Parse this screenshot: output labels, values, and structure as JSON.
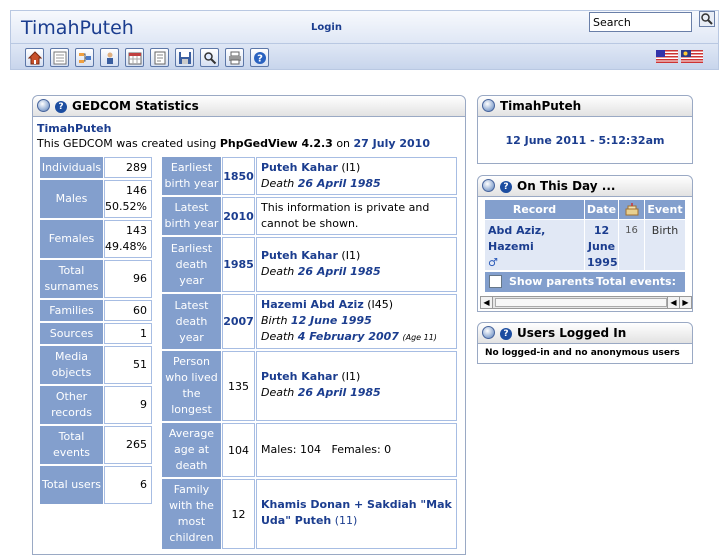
{
  "header": {
    "site_title": "TimahPuteh",
    "login_label": "Login",
    "search_placeholder": "Search"
  },
  "toolbar": {
    "icons": [
      "home-icon",
      "list-icon",
      "tree-icon",
      "individual-icon",
      "calendar-icon",
      "report-icon",
      "save-icon",
      "search-icon",
      "print-icon",
      "help-icon"
    ],
    "flags": [
      "us-flag-icon",
      "malaysia-flag-icon"
    ]
  },
  "gedcom_stats": {
    "title": "GEDCOM Statistics",
    "site_name": "TimahPuteh",
    "created_prefix": "This GEDCOM was created using ",
    "software": "PhpGedView 4.2.3",
    "created_on": " on ",
    "created_date": "27 July 2010",
    "left_table": [
      {
        "label": "Individuals",
        "value": "289"
      },
      {
        "label": "Males",
        "value": "146",
        "value2": "50.52%"
      },
      {
        "label": "Females",
        "value": "143",
        "value2": "49.48%"
      },
      {
        "label": "Total surnames",
        "value": "96"
      },
      {
        "label": "Families",
        "value": "60"
      },
      {
        "label": "Sources",
        "value": "1"
      },
      {
        "label": "Media objects",
        "value": "51"
      },
      {
        "label": "Other records",
        "value": "9"
      },
      {
        "label": "Total events",
        "value": "265"
      },
      {
        "label": "Total users",
        "value": "6"
      }
    ],
    "right_table": {
      "earliest_birth": {
        "label": "Earliest birth year",
        "year": "1850",
        "name": "Puteh Kahar",
        "id": "(I1)",
        "event_word": "Death",
        "event_date": "26 April 1985"
      },
      "latest_birth": {
        "label": "Latest birth year",
        "year": "2010",
        "text": "This information is private and cannot be shown."
      },
      "earliest_death": {
        "label": "Earliest death year",
        "year": "1985",
        "name": "Puteh Kahar",
        "id": "(I1)",
        "event_word": "Death",
        "event_date": "26 April 1985"
      },
      "latest_death": {
        "label": "Latest death year",
        "year": "2007",
        "name": "Hazemi Abd Aziz",
        "id": "(I45)",
        "birth_word": "Birth",
        "birth_date": "12 June 1995",
        "death_word": "Death",
        "death_date": "4 February 2007",
        "age_note": "(Age 11)"
      },
      "longest_lived": {
        "label": "Person who lived the longest",
        "value": "135",
        "name": "Puteh Kahar",
        "id": "(I1)",
        "event_word": "Death",
        "event_date": "26 April 1985"
      },
      "average_age": {
        "label": "Average age at death",
        "value": "104",
        "text": "Males: 104   Females: 0"
      },
      "most_children": {
        "label": "Family with the most children",
        "value": "12",
        "name": "Khamis Donan + Sakdiah \"Mak Uda\" Puteh",
        "id": "(11)"
      }
    }
  },
  "timah_block": {
    "title": "TimahPuteh",
    "datetime": "12 June 2011 - 5:12:32am"
  },
  "on_this_day": {
    "title": "On This Day ...",
    "headers": {
      "record": "Record",
      "date": "Date",
      "event": "Event"
    },
    "row": {
      "record": "Abd Aziz, Hazemi",
      "gender_symbol": "♂",
      "date": "12 June 1995",
      "age": "16",
      "event": "Birth"
    },
    "show_parents_label": "Show parents",
    "total_events": "Total events: 1"
  },
  "users_logged_in": {
    "title": "Users Logged In",
    "text": "No logged-in and no anonymous users"
  },
  "colors": {
    "accent": "#1b3d8f",
    "label_bg": "#839fcd",
    "cell_border": "#a7bde3"
  }
}
